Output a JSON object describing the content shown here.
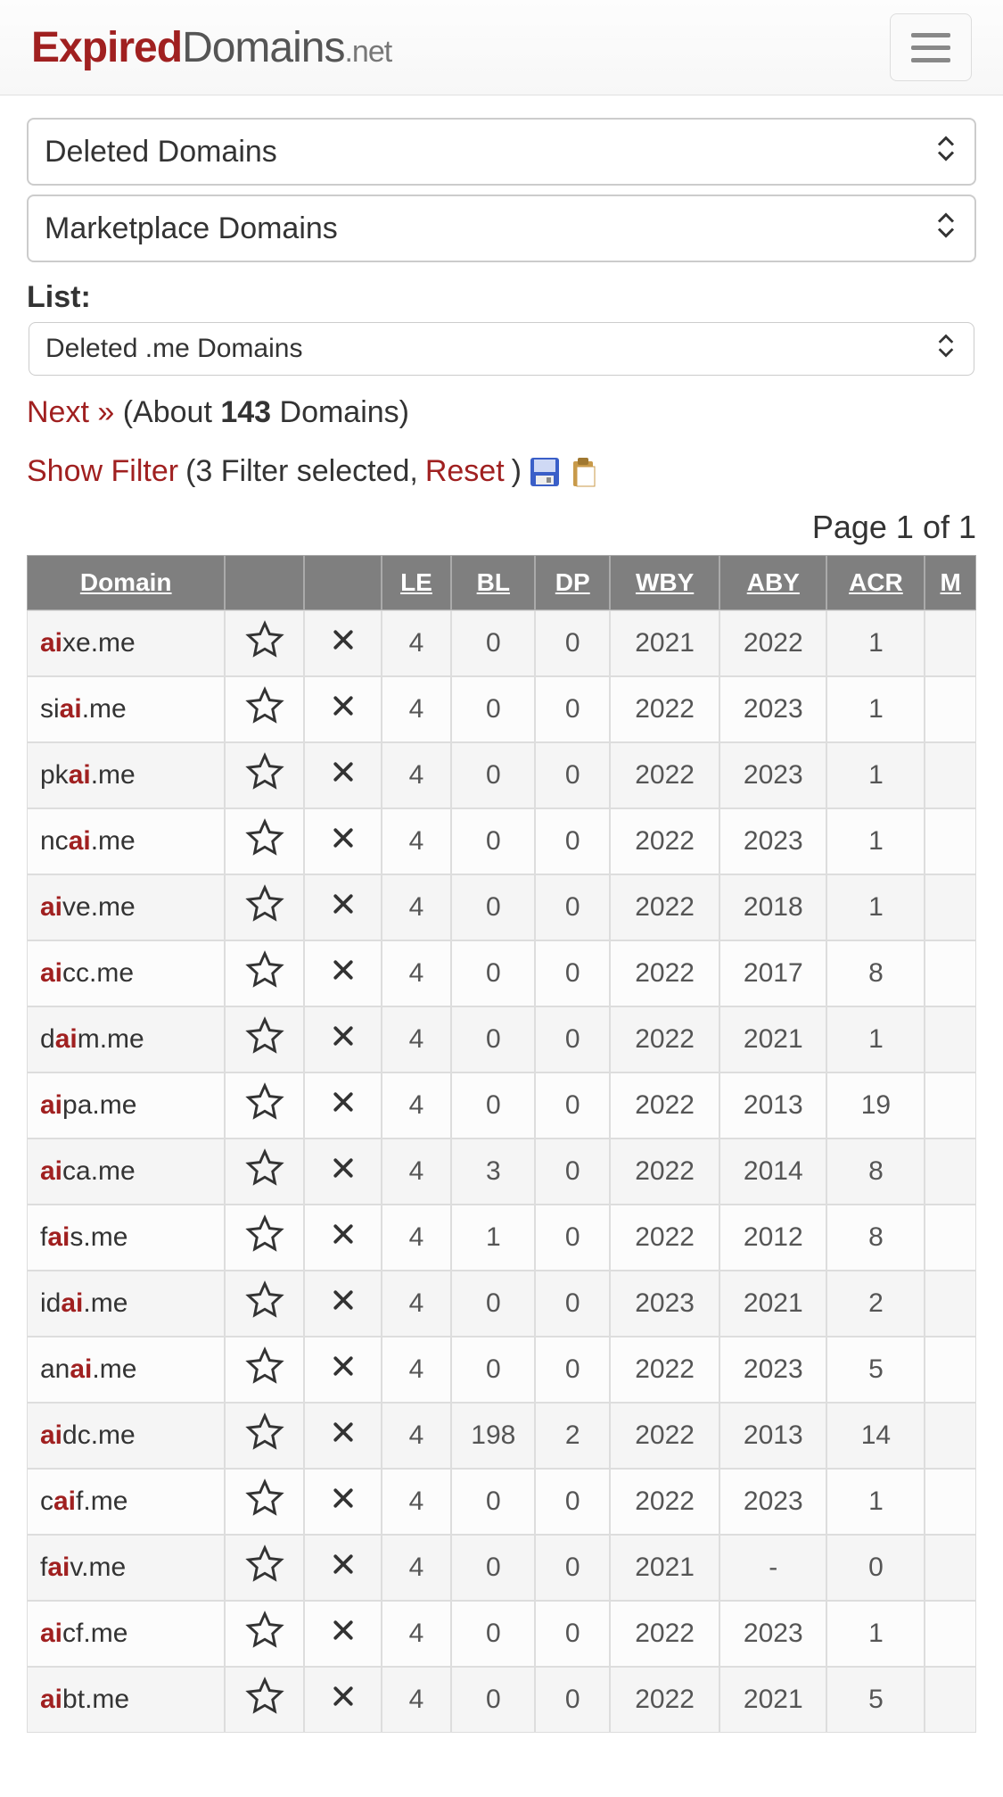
{
  "header": {
    "logo_part1": "Expired",
    "logo_part2": "Domains",
    "logo_part3": ".net"
  },
  "selects": {
    "deleted": "Deleted Domains",
    "marketplace": "Marketplace Domains",
    "list_label": "List:",
    "list_value": "Deleted .me Domains"
  },
  "meta": {
    "next_label": "Next »",
    "about_prefix": "(About ",
    "count": "143",
    "about_suffix": " Domains)"
  },
  "filter": {
    "show_label": "Show Filter",
    "middle": " (3 Filter selected, ",
    "reset_label": "Reset",
    "close": ") "
  },
  "page": "Page 1 of 1",
  "headers": [
    "Domain",
    "",
    "",
    "LE",
    "BL",
    "DP",
    "WBY",
    "ABY",
    "ACR",
    "M"
  ],
  "rows": [
    {
      "pre": "",
      "hl": "ai",
      "post": "xe",
      "tld": ".me",
      "le": "4",
      "bl": "0",
      "dp": "0",
      "wby": "2021",
      "aby": "2022",
      "acr": "1"
    },
    {
      "pre": "si",
      "hl": "ai",
      "post": "",
      "tld": ".me",
      "le": "4",
      "bl": "0",
      "dp": "0",
      "wby": "2022",
      "aby": "2023",
      "acr": "1"
    },
    {
      "pre": "pk",
      "hl": "ai",
      "post": "",
      "tld": ".me",
      "le": "4",
      "bl": "0",
      "dp": "0",
      "wby": "2022",
      "aby": "2023",
      "acr": "1"
    },
    {
      "pre": "nc",
      "hl": "ai",
      "post": "",
      "tld": ".me",
      "le": "4",
      "bl": "0",
      "dp": "0",
      "wby": "2022",
      "aby": "2023",
      "acr": "1"
    },
    {
      "pre": "",
      "hl": "ai",
      "post": "ve",
      "tld": ".me",
      "le": "4",
      "bl": "0",
      "dp": "0",
      "wby": "2022",
      "aby": "2018",
      "acr": "1"
    },
    {
      "pre": "",
      "hl": "ai",
      "post": "cc",
      "tld": ".me",
      "le": "4",
      "bl": "0",
      "dp": "0",
      "wby": "2022",
      "aby": "2017",
      "acr": "8"
    },
    {
      "pre": "d",
      "hl": "ai",
      "post": "m",
      "tld": ".me",
      "le": "4",
      "bl": "0",
      "dp": "0",
      "wby": "2022",
      "aby": "2021",
      "acr": "1"
    },
    {
      "pre": "",
      "hl": "ai",
      "post": "pa",
      "tld": ".me",
      "le": "4",
      "bl": "0",
      "dp": "0",
      "wby": "2022",
      "aby": "2013",
      "acr": "19"
    },
    {
      "pre": "",
      "hl": "ai",
      "post": "ca",
      "tld": ".me",
      "le": "4",
      "bl": "3",
      "dp": "0",
      "wby": "2022",
      "aby": "2014",
      "acr": "8"
    },
    {
      "pre": "f",
      "hl": "ai",
      "post": "s",
      "tld": ".me",
      "le": "4",
      "bl": "1",
      "dp": "0",
      "wby": "2022",
      "aby": "2012",
      "acr": "8"
    },
    {
      "pre": "id",
      "hl": "ai",
      "post": "",
      "tld": ".me",
      "le": "4",
      "bl": "0",
      "dp": "0",
      "wby": "2023",
      "aby": "2021",
      "acr": "2"
    },
    {
      "pre": "an",
      "hl": "ai",
      "post": "",
      "tld": ".me",
      "le": "4",
      "bl": "0",
      "dp": "0",
      "wby": "2022",
      "aby": "2023",
      "acr": "5"
    },
    {
      "pre": "",
      "hl": "ai",
      "post": "dc",
      "tld": ".me",
      "le": "4",
      "bl": "198",
      "dp": "2",
      "wby": "2022",
      "aby": "2013",
      "acr": "14"
    },
    {
      "pre": "c",
      "hl": "ai",
      "post": "f",
      "tld": ".me",
      "le": "4",
      "bl": "0",
      "dp": "0",
      "wby": "2022",
      "aby": "2023",
      "acr": "1"
    },
    {
      "pre": "f",
      "hl": "ai",
      "post": "v",
      "tld": ".me",
      "le": "4",
      "bl": "0",
      "dp": "0",
      "wby": "2021",
      "aby": "-",
      "acr": "0"
    },
    {
      "pre": "",
      "hl": "ai",
      "post": "cf",
      "tld": ".me",
      "le": "4",
      "bl": "0",
      "dp": "0",
      "wby": "2022",
      "aby": "2023",
      "acr": "1"
    },
    {
      "pre": "",
      "hl": "ai",
      "post": "bt",
      "tld": ".me",
      "le": "4",
      "bl": "0",
      "dp": "0",
      "wby": "2022",
      "aby": "2021",
      "acr": "5"
    }
  ]
}
